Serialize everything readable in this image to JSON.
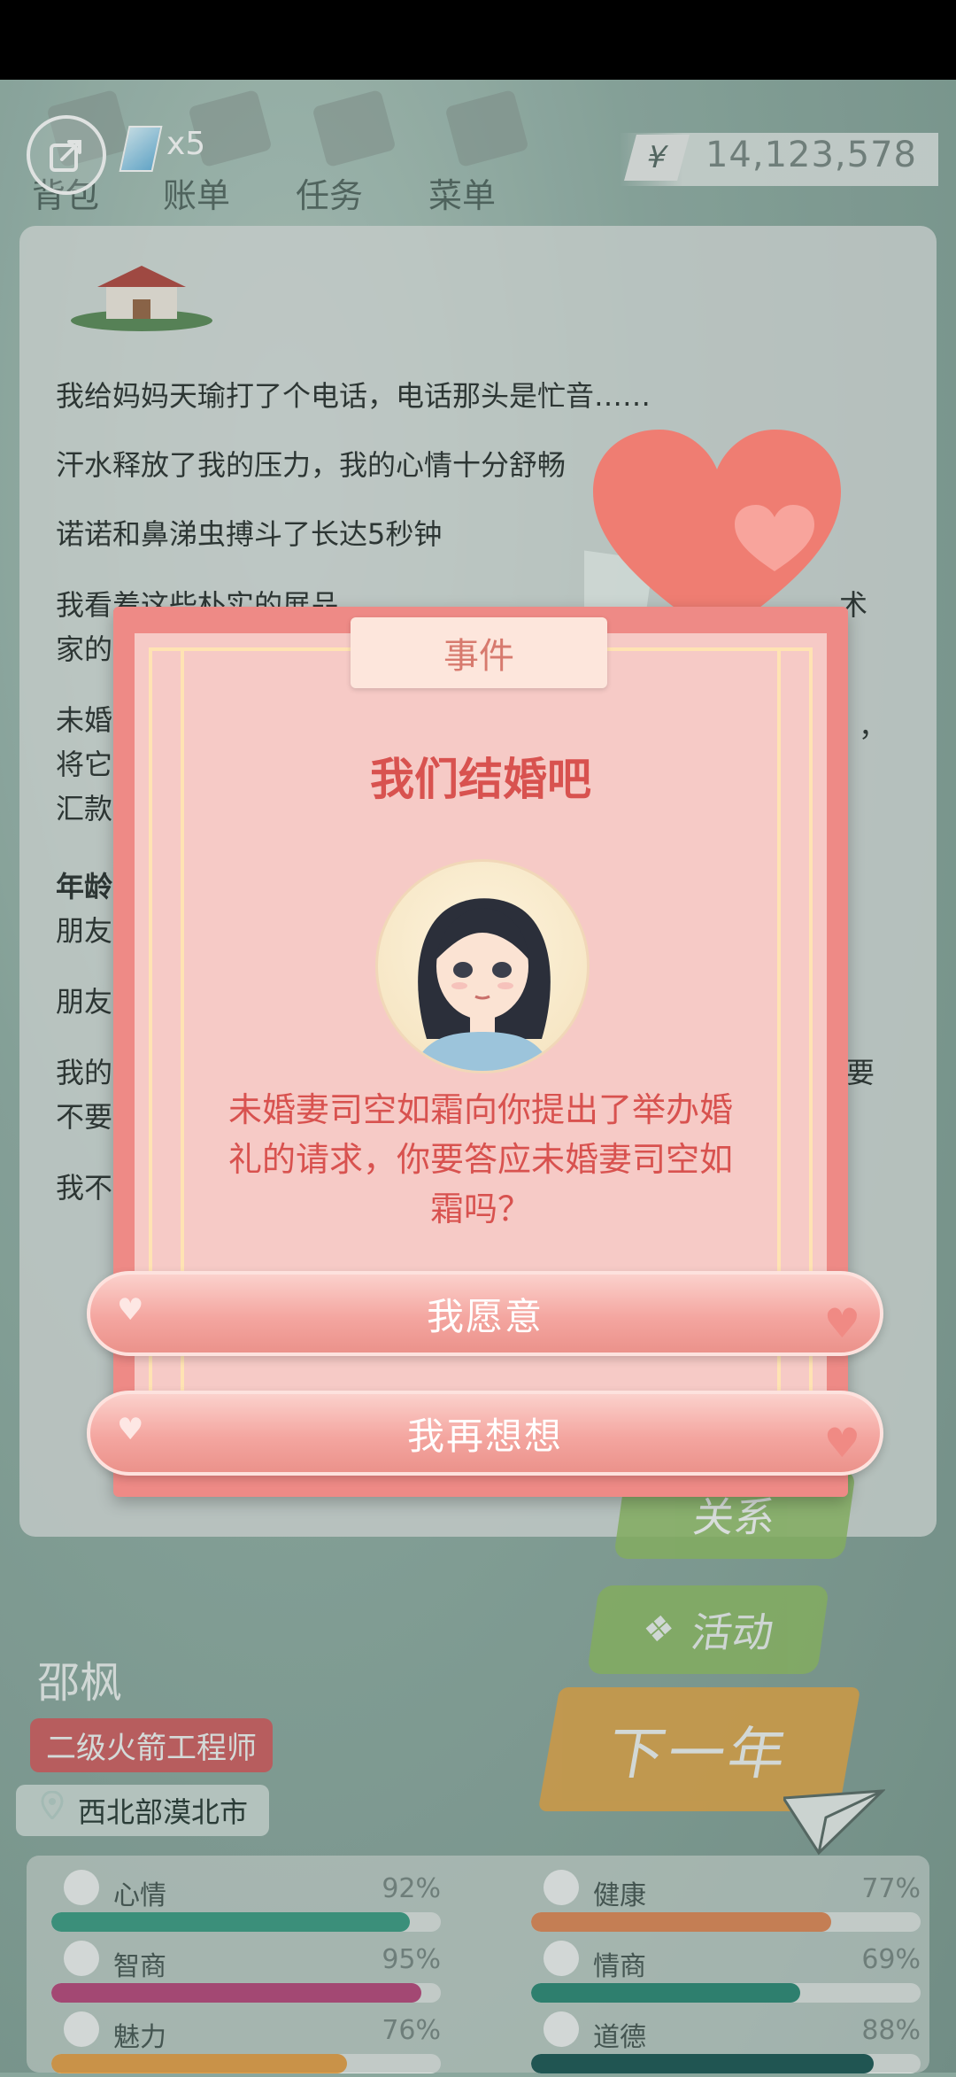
{
  "topbar": {
    "nav": [
      "背包",
      "账单",
      "任务",
      "菜单"
    ],
    "gem_count": "x5",
    "currency_symbol": "¥",
    "money": "14,123,578"
  },
  "log": {
    "lines": [
      "我给妈妈天瑜打了个电话，电话那头是忙音……",
      "汗水释放了我的压力，我的心情十分舒畅",
      "诺诺和鼻涕虫搏斗了长达5秒钟",
      "我看着这些朴实的展品",
      "家的",
      "未婚",
      "将它",
      "汇款",
      "年龄",
      "朋友",
      "朋友",
      "我的",
      "不要",
      "我不"
    ],
    "right_fragments": [
      "术",
      "，",
      "要"
    ]
  },
  "character": {
    "name": "邵枫",
    "job": "二级火箭工程师",
    "location": "西北部漠北市"
  },
  "side_buttons": {
    "relations": "关系",
    "activity": "活动",
    "next_year": "下一年"
  },
  "stats": [
    {
      "label": "心情",
      "value": "92%",
      "fraction": 0.92,
      "color": "#3f9e86",
      "icon": "smile-icon"
    },
    {
      "label": "健康",
      "value": "77%",
      "fraction": 0.77,
      "color": "#e08a5a",
      "icon": "heart-icon"
    },
    {
      "label": "智商",
      "value": "95%",
      "fraction": 0.95,
      "color": "#b94a7e",
      "icon": "bulb-icon"
    },
    {
      "label": "情商",
      "value": "69%",
      "fraction": 0.69,
      "color": "#2f8b78",
      "icon": "apple-icon"
    },
    {
      "label": "魅力",
      "value": "76%",
      "fraction": 0.76,
      "color": "#e5a24c",
      "icon": "sparkle-icon"
    },
    {
      "label": "道德",
      "value": "88%",
      "fraction": 0.88,
      "color": "#1f5a57",
      "icon": "scales-icon"
    }
  ],
  "modal": {
    "tab": "事件",
    "title": "我们结婚吧",
    "message": "未婚妻司空如霜向你提出了举办婚礼的请求，你要答应未婚妻司空如霜吗？",
    "accept": "我愿意",
    "decline": "我再想想"
  }
}
